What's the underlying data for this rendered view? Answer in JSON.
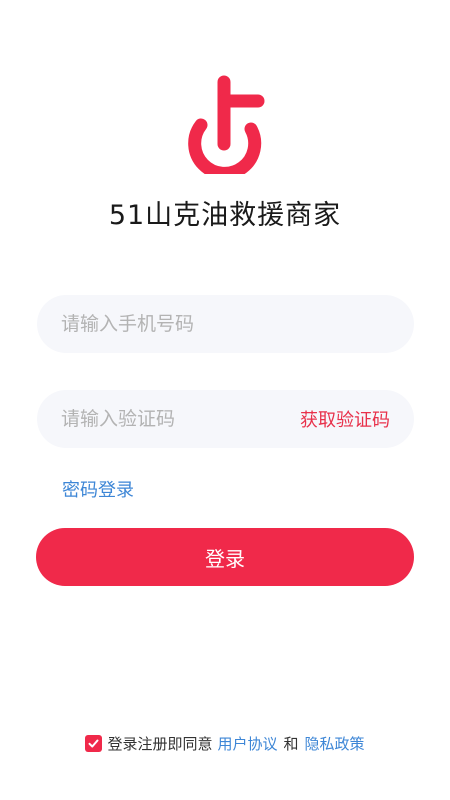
{
  "app": {
    "title": "51山克油救援商家"
  },
  "form": {
    "phone_placeholder": "请输入手机号码",
    "code_placeholder": "请输入验证码",
    "get_code_label": "获取验证码",
    "password_login_label": "密码登录",
    "login_button_label": "登录"
  },
  "agreement": {
    "checked": true,
    "text": "登录注册即同意",
    "user_agreement_label": "用户协议",
    "and_text": "和",
    "privacy_policy_label": "隐私政策"
  },
  "colors": {
    "brand": "#f0294a",
    "link": "#3d86d6",
    "input_bg": "#f6f7fb"
  },
  "icons": {
    "logo": "brand-logo-icon",
    "checkbox": "checkmark-icon"
  }
}
